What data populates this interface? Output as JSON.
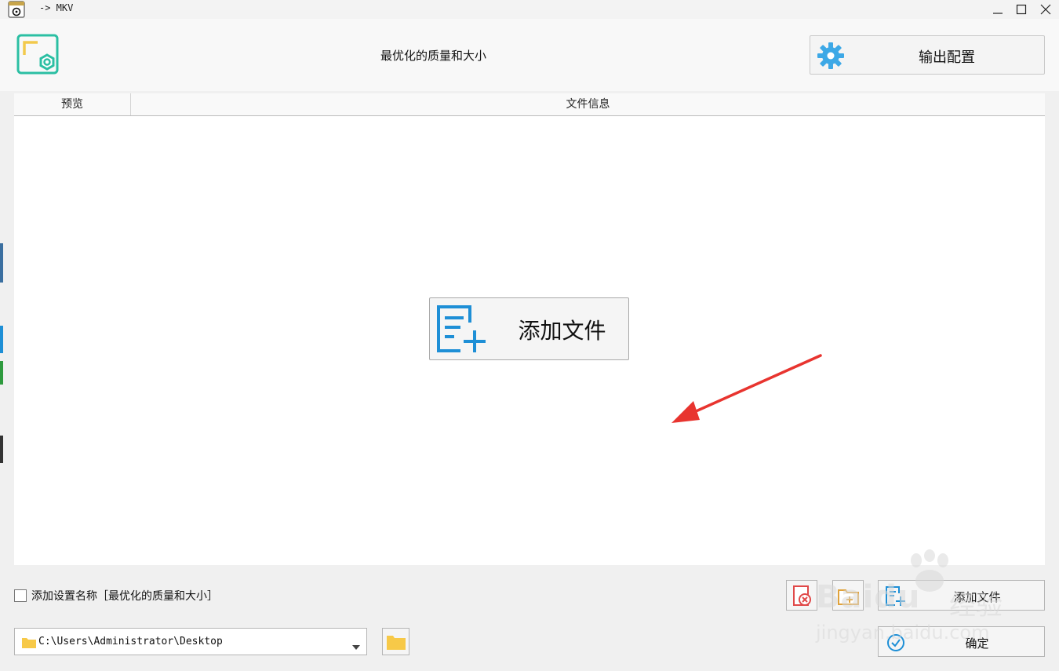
{
  "window": {
    "title": "-> MKV",
    "controls": {
      "minimize": "minimize",
      "maximize": "maximize",
      "close": "close"
    }
  },
  "header": {
    "profile_title": "最优化的质量和大小",
    "output_config_label": "输出配置"
  },
  "file_list": {
    "columns": [
      "预览",
      "文件信息"
    ],
    "add_file_label": "添加文件"
  },
  "footer": {
    "checkbox_label": "添加设置名称［最优化的质量和大小］",
    "checkbox_checked": false,
    "output_path": "C:\\Users\\Administrator\\Desktop",
    "add_file_label": "添加文件",
    "ok_label": "确定"
  },
  "watermark": {
    "brand": "Baidu",
    "brand_cn": "经验",
    "url": "jingyan.baidu.com"
  },
  "colors": {
    "accent_teal": "#2bbfa3",
    "accent_yellow": "#f2c94c",
    "gear_blue": "#3da8e6",
    "add_icon_blue": "#1e8fd6",
    "arrow_red": "#e8342f",
    "folder_yellow": "#f7c948",
    "clear_red": "#e04848"
  }
}
